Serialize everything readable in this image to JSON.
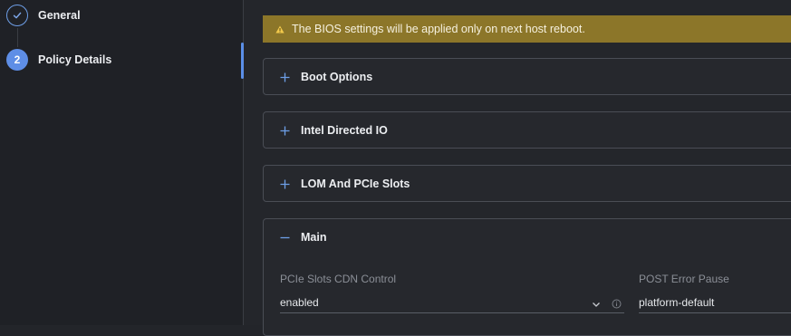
{
  "stepper": {
    "steps": [
      {
        "label": "General",
        "state": "complete",
        "icon": "check-icon"
      },
      {
        "label": "Policy Details",
        "state": "current",
        "number": "2"
      }
    ]
  },
  "banner": {
    "text": "The BIOS settings will be applied only on next host reboot.",
    "icon": "warning-triangle-icon",
    "color": "#8c7629"
  },
  "panels": [
    {
      "title": "Boot Options",
      "expanded": false,
      "icon": "plus-icon"
    },
    {
      "title": "Intel Directed IO",
      "expanded": false,
      "icon": "plus-icon"
    },
    {
      "title": "LOM And PCIe Slots",
      "expanded": false,
      "icon": "plus-icon"
    },
    {
      "title": "Main",
      "expanded": true,
      "icon": "minus-icon"
    }
  ],
  "main_section": {
    "fields": [
      {
        "label": "PCIe Slots CDN Control",
        "value": "enabled",
        "control": "select"
      },
      {
        "label": "POST Error Pause",
        "value": "platform-default",
        "control": "select"
      }
    ]
  },
  "colors": {
    "accent": "#5e8ee6",
    "background": "#24262b",
    "warning": "#8c7629"
  }
}
